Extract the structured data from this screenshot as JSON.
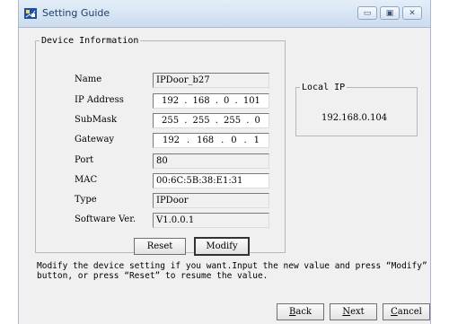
{
  "window": {
    "title": "Setting Guide",
    "controls": {
      "minimize": "▭",
      "maximize": "▣",
      "close": "✕"
    }
  },
  "device_info": {
    "legend": "Device Information",
    "fields": [
      {
        "label": "Name",
        "value": "IPDoor_b27",
        "editable": false
      },
      {
        "label": "IP Address",
        "octets": [
          "192",
          "168",
          "0",
          "101"
        ],
        "editable": true
      },
      {
        "label": "SubMask",
        "octets": [
          "255",
          "255",
          "255",
          "0"
        ],
        "editable": true
      },
      {
        "label": "Gateway",
        "octets": [
          "192",
          "168",
          "0",
          "1"
        ],
        "editable": true
      },
      {
        "label": "Port",
        "value": "80",
        "editable": false
      },
      {
        "label": "MAC",
        "value": "00:6C:5B:38:E1:31",
        "editable": true
      },
      {
        "label": "Type",
        "value": "IPDoor",
        "editable": false
      },
      {
        "label": "Software Ver.",
        "value": "V1.0.0.1",
        "editable": false
      }
    ],
    "reset_label": "Reset",
    "modify_label": "Modify"
  },
  "local_ip": {
    "legend": "Local IP",
    "value": "192.168.0.104"
  },
  "note": "Modify the device setting if you want.Input the new value and press “Modify” button, or press “Reset” to resume the value.",
  "nav": {
    "back_prefix": "B",
    "back_rest": "ack",
    "next_prefix": "N",
    "next_rest": "ext",
    "cancel_prefix": "C",
    "cancel_rest": "ancel"
  },
  "colors": {
    "title_bar": "#cbdcef",
    "window_bg": "#f0f0f0",
    "group_border": "#b8b8b8"
  }
}
